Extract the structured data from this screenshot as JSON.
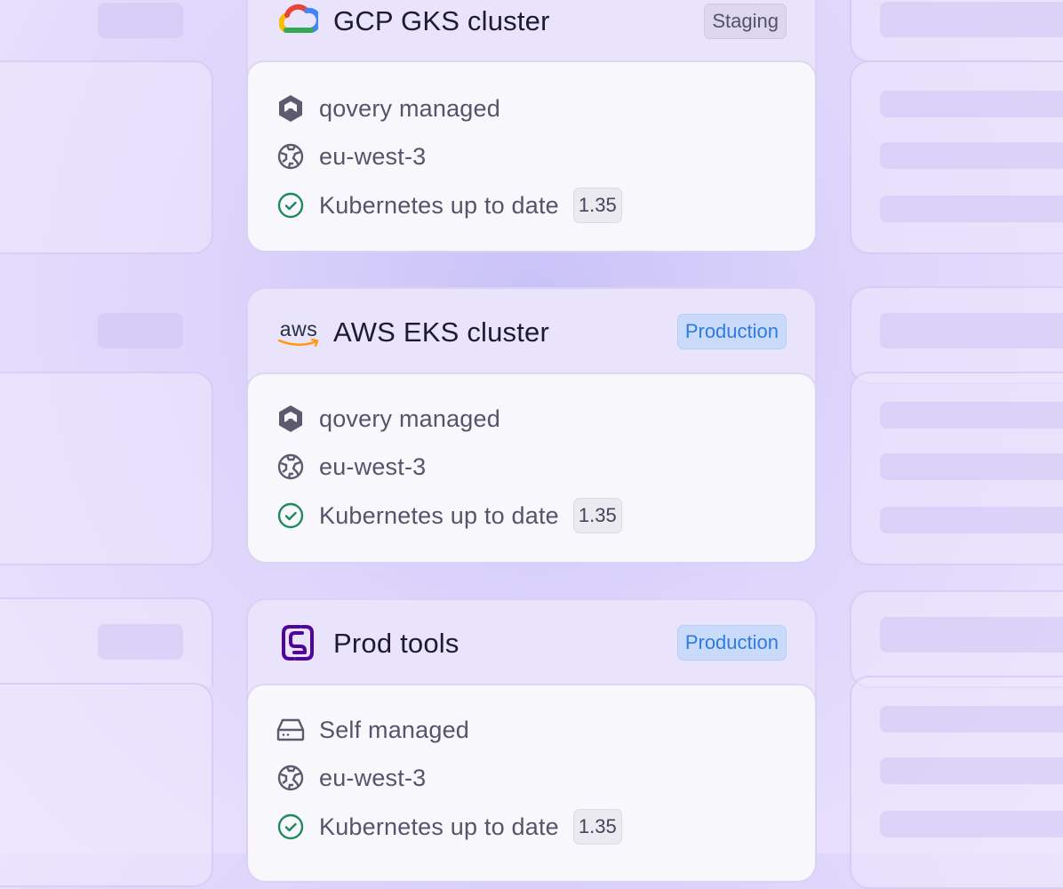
{
  "clusters": [
    {
      "name": "GCP GKS cluster",
      "provider_icon": "google-cloud-icon",
      "environment": "Staging",
      "management": "qovery managed",
      "management_icon": "qovery-icon",
      "region": "eu-west-3",
      "status": "Kubernetes up to date",
      "version": "1.35"
    },
    {
      "name": "AWS EKS cluster",
      "provider_icon": "aws-icon",
      "provider_logo_text": "aws",
      "environment": "Production",
      "management": "qovery managed",
      "management_icon": "qovery-icon",
      "region": "eu-west-3",
      "status": "Kubernetes up to date",
      "version": "1.35"
    },
    {
      "name": "Prod tools",
      "provider_icon": "scaleway-icon",
      "environment": "Production",
      "management": "Self managed",
      "management_icon": "server-icon",
      "region": "eu-west-3",
      "status": "Kubernetes up to date",
      "version": "1.35"
    }
  ],
  "colors": {
    "status_ok": "#1f8a5b",
    "production_badge": "#2e7cdc",
    "staging_badge": "#555266",
    "scaleway_purple": "#4f0599"
  }
}
